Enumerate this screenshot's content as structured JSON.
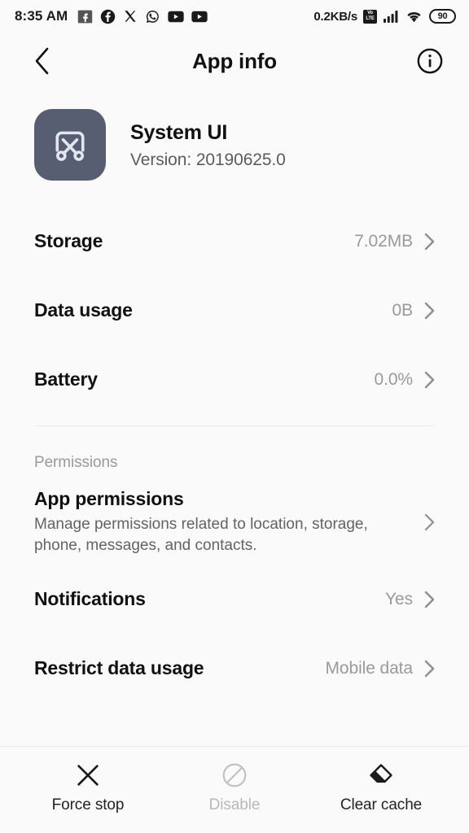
{
  "statusbar": {
    "clock": "8:35 AM",
    "network_speed": "0.2KB/s",
    "volte_top": "Vo",
    "volte_bottom": "LTE",
    "battery_level": "90",
    "left_icons": [
      "facebook-lite-notification-icon",
      "facebook-icon",
      "x-twitter-icon",
      "whatsapp-icon",
      "youtube-icon",
      "youtube-music-icon"
    ],
    "right_icons": [
      "volte-icon",
      "signal-bars-icon",
      "wifi-icon",
      "battery-icon"
    ]
  },
  "header": {
    "title": "App info",
    "back_icon": "chevron-left-icon",
    "info_icon": "info-circle-icon"
  },
  "app": {
    "name": "System UI",
    "version": "Version: 20190625.0",
    "icon_name": "scissors-screenshot-icon",
    "icon_bg": "#585e72",
    "icon_fg": "#e3e5ef"
  },
  "usage_rows": [
    {
      "label": "Storage",
      "value": "7.02MB",
      "name": "storage"
    },
    {
      "label": "Data usage",
      "value": "0B",
      "name": "data-usage"
    },
    {
      "label": "Battery",
      "value": "0.0%",
      "name": "battery"
    }
  ],
  "permissions_section": {
    "header": "Permissions",
    "app_permissions": {
      "label": "App permissions",
      "description": "Manage permissions related to location, storage, phone, messages, and contacts."
    },
    "notifications": {
      "label": "Notifications",
      "value": "Yes"
    },
    "restrict_data_usage": {
      "label": "Restrict data usage",
      "value": "Mobile data"
    }
  },
  "bottombar": {
    "actions": [
      {
        "label": "Force stop",
        "icon": "close-x-icon",
        "name": "force-stop",
        "disabled": false
      },
      {
        "label": "Disable",
        "icon": "block-circle-icon",
        "name": "disable",
        "disabled": true
      },
      {
        "label": "Clear cache",
        "icon": "eraser-icon",
        "name": "clear-cache",
        "disabled": false
      }
    ]
  },
  "colors": {
    "background": "#fafafa",
    "primary_text": "#111111",
    "secondary_text": "#9a9a9a",
    "divider": "#ececec"
  }
}
